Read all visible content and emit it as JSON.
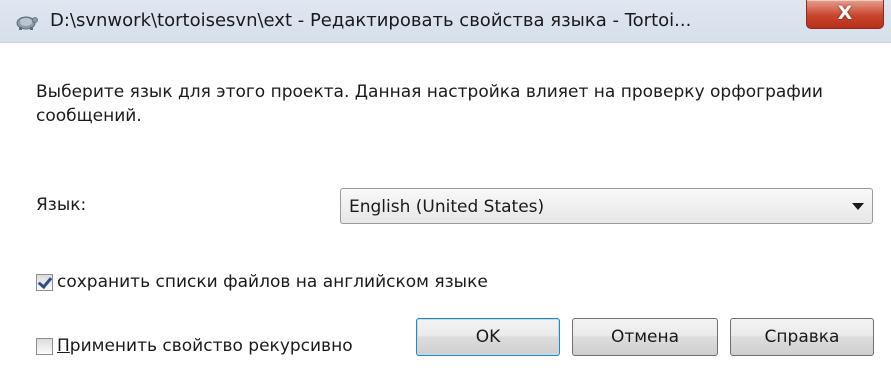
{
  "window": {
    "title": "D:\\svnwork\\tortoisesvn\\ext - Редактировать свойства языка - Tortoi...",
    "close_label": "X"
  },
  "dialog": {
    "description": "Выберите язык для этого проекта. Данная настройка влияет на проверку орфографии сообщений.",
    "language_label": "Язык:",
    "language_selected": "English (United States)",
    "keep_filelist_label": "сохранить списки файлов на английском языке",
    "keep_filelist_checked": true,
    "recursive_label": "Применить свойство рекурсивно",
    "recursive_checked": false
  },
  "buttons": {
    "ok": "OK",
    "cancel": "Отмена",
    "help": "Справка"
  },
  "icons": {
    "app": "tortoisesvn-icon",
    "dropdown": "chevron-down-icon"
  }
}
